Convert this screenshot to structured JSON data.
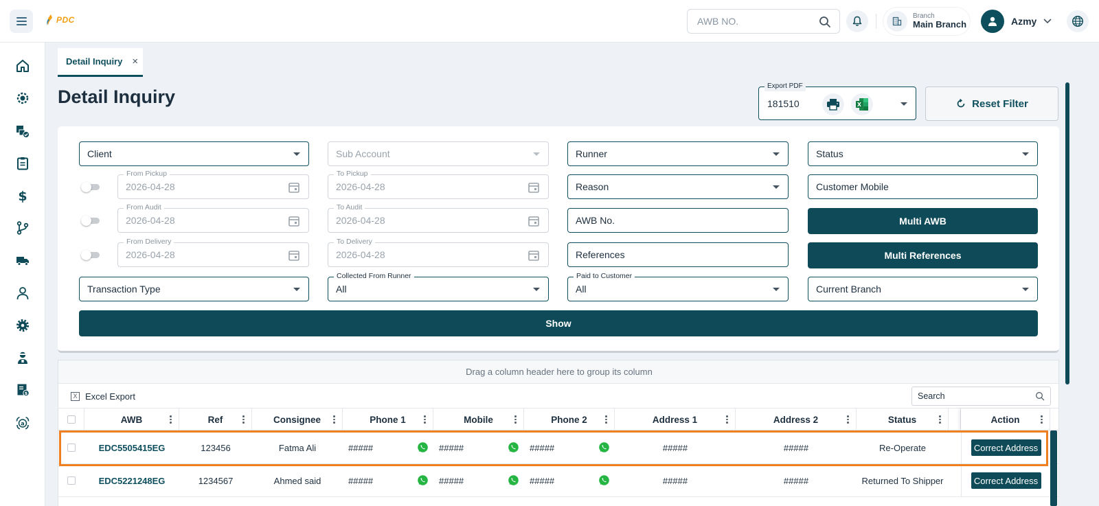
{
  "header": {
    "logo_text": "PDC",
    "awb_search_placeholder": "AWB NO.",
    "branch_caption": "Branch",
    "branch_name": "Main Branch",
    "user_name": "Azmy"
  },
  "sidebar": {
    "items": [
      {
        "icon": "home-icon"
      },
      {
        "icon": "dashboard-gear-icon"
      },
      {
        "icon": "boxes-check-icon"
      },
      {
        "icon": "clipboard-icon"
      },
      {
        "icon": "dollar-icon"
      },
      {
        "icon": "branch-icon"
      },
      {
        "icon": "truck-icon"
      },
      {
        "icon": "user-icon"
      },
      {
        "icon": "settings-icon"
      },
      {
        "icon": "agent-icon"
      },
      {
        "icon": "invoice-icon"
      },
      {
        "icon": "hand-money-icon"
      }
    ]
  },
  "tabs": [
    {
      "label": "Detail Inquiry"
    }
  ],
  "page": {
    "title": "Detail Inquiry",
    "export_legend": "Export PDF",
    "export_value": "181510",
    "reset_label": "Reset Filter"
  },
  "filters": {
    "client": "Client",
    "sub_account": "Sub Account",
    "runner": "Runner",
    "status": "Status",
    "from_pickup_label": "From Pickup",
    "from_pickup": "2026-04-28",
    "to_pickup_label": "To Pickup",
    "to_pickup": "2026-04-28",
    "reason": "Reason",
    "customer_mobile": "Customer Mobile",
    "from_audit_label": "From Audit",
    "from_audit": "2026-04-28",
    "to_audit_label": "To Audit",
    "to_audit": "2026-04-28",
    "awb_no": "AWB No.",
    "multi_awb": "Multi AWB",
    "from_delivery_label": "From Delivery",
    "from_delivery": "2026-04-28",
    "to_delivery_label": "To Delivery",
    "to_delivery": "2026-04-28",
    "references": "References",
    "multi_references": "Multi References",
    "transaction_type": "Transaction Type",
    "collected_label": "Collected From Runner",
    "collected_value": "All",
    "paid_label": "Paid to Customer",
    "paid_value": "All",
    "current_branch": "Current Branch",
    "show": "Show"
  },
  "grid": {
    "group_hint": "Drag a column header here to group its column",
    "excel_export": "Excel Export",
    "search_placeholder": "Search",
    "columns": [
      "AWB",
      "Ref",
      "Consignee",
      "Phone 1",
      "Mobile",
      "Phone 2",
      "Address 1",
      "Address 2",
      "Status",
      "Action"
    ],
    "rows": [
      {
        "awb": "EDC5505415EG",
        "ref": "123456",
        "consignee": "Fatma Ali",
        "phone1": "#####",
        "mobile": "#####",
        "phone2": "#####",
        "address1": "#####",
        "address2": "#####",
        "status": "Re-Operate",
        "action": "Correct Address"
      },
      {
        "awb": "EDC5221248EG",
        "ref": "1234567",
        "consignee": "Ahmed said",
        "phone1": "#####",
        "mobile": "#####",
        "phone2": "#####",
        "address1": "#####",
        "address2": "#####",
        "status": "Returned To Shipper",
        "action": "Correct Address"
      }
    ]
  },
  "colors": {
    "primary": "#0e4a58",
    "highlight": "#f07f22",
    "whatsapp": "#25b543",
    "brand_orange": "#f3a015"
  }
}
